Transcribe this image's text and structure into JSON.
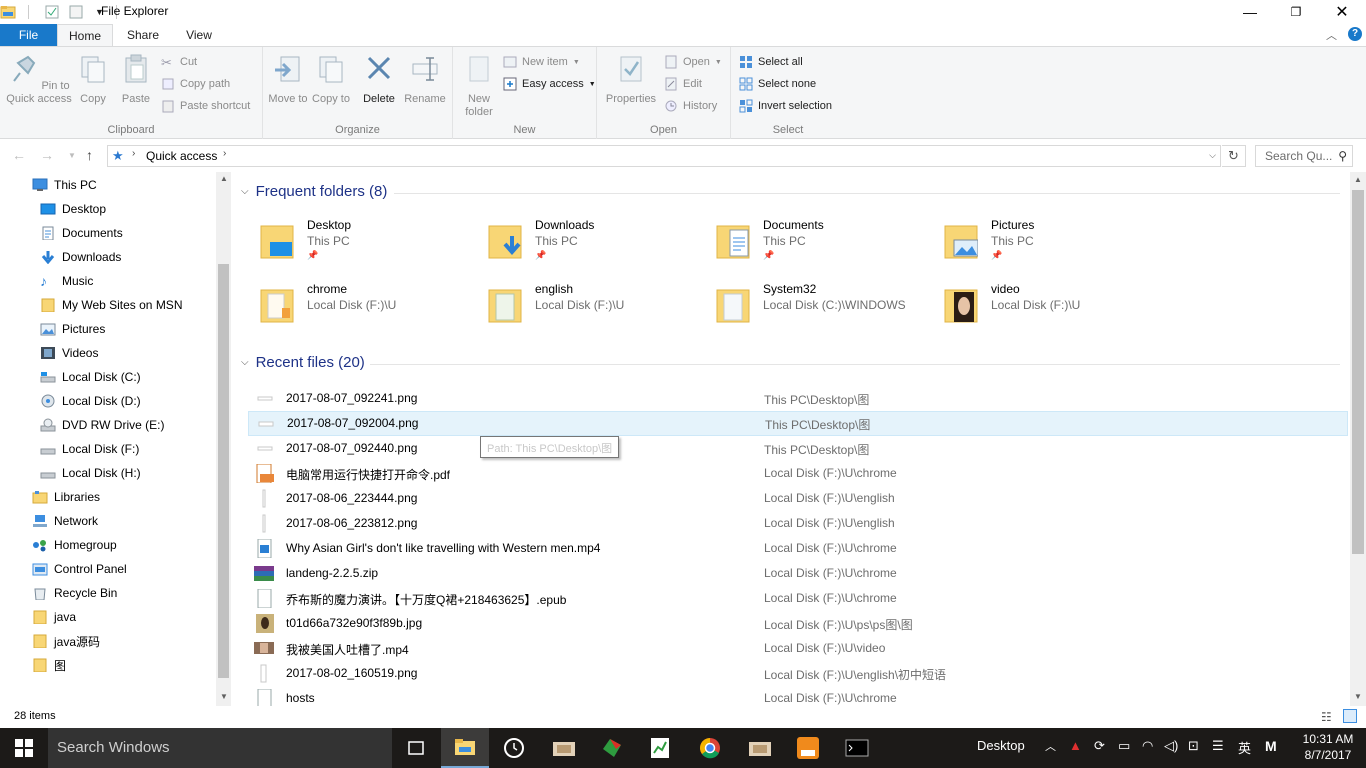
{
  "window": {
    "title": "File Explorer",
    "controls": [
      "minimize",
      "maximize",
      "close"
    ]
  },
  "ribbon_tabs": [
    "File",
    "Home",
    "Share",
    "View"
  ],
  "ribbon": {
    "clipboard": {
      "label": "Clipboard",
      "pin": "Pin to Quick access",
      "copy": "Copy",
      "paste": "Paste",
      "cut": "Cut",
      "copy_path": "Copy path",
      "paste_shortcut": "Paste shortcut"
    },
    "organize": {
      "label": "Organize",
      "move_to": "Move to",
      "copy_to": "Copy to",
      "delete": "Delete",
      "rename": "Rename"
    },
    "new": {
      "label": "New",
      "new_folder": "New folder",
      "new_item": "New item",
      "easy_access": "Easy access"
    },
    "open": {
      "label": "Open",
      "properties": "Properties",
      "open": "Open",
      "edit": "Edit",
      "history": "History"
    },
    "select": {
      "label": "Select",
      "select_all": "Select all",
      "select_none": "Select none",
      "invert": "Invert selection"
    }
  },
  "address": {
    "path": "Quick access",
    "search_placeholder": "Search Qu..."
  },
  "nav_items": [
    {
      "label": "This PC",
      "icon": "computer-icon",
      "level": 0
    },
    {
      "label": "Desktop",
      "icon": "desktop-icon",
      "level": 1
    },
    {
      "label": "Documents",
      "icon": "documents-icon",
      "level": 1
    },
    {
      "label": "Downloads",
      "icon": "downloads-icon",
      "level": 1
    },
    {
      "label": "Music",
      "icon": "music-icon",
      "level": 1
    },
    {
      "label": "My Web Sites on MSN",
      "icon": "folder-icon",
      "level": 1
    },
    {
      "label": "Pictures",
      "icon": "pictures-icon",
      "level": 1
    },
    {
      "label": "Videos",
      "icon": "videos-icon",
      "level": 1
    },
    {
      "label": "Local Disk (C:)",
      "icon": "drive-icon",
      "level": 1
    },
    {
      "label": "Local Disk (D:)",
      "icon": "disc-drive-icon",
      "level": 1
    },
    {
      "label": "DVD RW Drive (E:)",
      "icon": "dvd-drive-icon",
      "level": 1
    },
    {
      "label": "Local Disk (F:)",
      "icon": "drive-icon",
      "level": 1
    },
    {
      "label": "Local Disk (H:)",
      "icon": "drive-icon",
      "level": 1
    },
    {
      "label": "Libraries",
      "icon": "libraries-icon",
      "level": 0
    },
    {
      "label": "Network",
      "icon": "network-icon",
      "level": 0
    },
    {
      "label": "Homegroup",
      "icon": "homegroup-icon",
      "level": 0
    },
    {
      "label": "Control Panel",
      "icon": "control-panel-icon",
      "level": 0
    },
    {
      "label": "Recycle Bin",
      "icon": "recycle-bin-icon",
      "level": 0
    },
    {
      "label": "java",
      "icon": "folder-icon",
      "level": 0
    },
    {
      "label": "java源码",
      "icon": "folder-icon",
      "level": 0
    },
    {
      "label": "图",
      "icon": "folder-icon",
      "level": 0
    }
  ],
  "frequent": {
    "heading": "Frequent folders (8)",
    "folders": [
      {
        "name": "Desktop",
        "sub": "This PC",
        "pinned": true
      },
      {
        "name": "Downloads",
        "sub": "This PC",
        "pinned": true
      },
      {
        "name": "Documents",
        "sub": "This PC",
        "pinned": true
      },
      {
        "name": "Pictures",
        "sub": "This PC",
        "pinned": true
      },
      {
        "name": "chrome",
        "sub": "Local Disk (F:)\\U",
        "pinned": false
      },
      {
        "name": "english",
        "sub": "Local Disk (F:)\\U",
        "pinned": false
      },
      {
        "name": "System32",
        "sub": "Local Disk (C:)\\WINDOWS",
        "pinned": false
      },
      {
        "name": "video",
        "sub": "Local Disk (F:)\\U",
        "pinned": false
      }
    ]
  },
  "recent": {
    "heading": "Recent files (20)",
    "files": [
      {
        "name": "2017-08-07_092241.png",
        "location": "This PC\\Desktop\\图",
        "icon": "image-file-icon"
      },
      {
        "name": "2017-08-07_092004.png",
        "location": "This PC\\Desktop\\图",
        "icon": "image-file-icon"
      },
      {
        "name": "2017-08-07_092440.png",
        "location": "This PC\\Desktop\\图",
        "icon": "image-file-icon"
      },
      {
        "name": "电脑常用运行快捷打开命令.pdf",
        "location": "Local Disk (F:)\\U\\chrome",
        "icon": "pdf-file-icon"
      },
      {
        "name": "2017-08-06_223444.png",
        "location": "Local Disk (F:)\\U\\english",
        "icon": "image-file-icon"
      },
      {
        "name": "2017-08-06_223812.png",
        "location": "Local Disk (F:)\\U\\english",
        "icon": "image-file-icon"
      },
      {
        "name": "Why Asian Girl's don't like travelling with Western men.mp4",
        "location": "Local Disk (F:)\\U\\chrome",
        "icon": "video-file-icon"
      },
      {
        "name": "landeng-2.2.5.zip",
        "location": "Local Disk (F:)\\U\\chrome",
        "icon": "zip-file-icon"
      },
      {
        "name": "乔布斯的魔力演讲。【十万度Q裙+218463625】.epub",
        "location": "Local Disk (F:)\\U\\chrome",
        "icon": "generic-file-icon"
      },
      {
        "name": "t01d66a732e90f3f89b.jpg",
        "location": "Local Disk (F:)\\U\\ps\\ps图\\图",
        "icon": "photo-file-icon"
      },
      {
        "name": "我被美国人吐槽了.mp4",
        "location": "Local Disk (F:)\\U\\video",
        "icon": "video-thumb-icon"
      },
      {
        "name": "2017-08-02_160519.png",
        "location": "Local Disk (F:)\\U\\english\\初中短语",
        "icon": "image-file-icon"
      },
      {
        "name": "hosts",
        "location": "Local Disk (F:)\\U\\chrome",
        "icon": "generic-file-icon"
      }
    ]
  },
  "tooltip": "Path: This PC\\Desktop\\图",
  "status": {
    "items": "28 items"
  },
  "taskbar": {
    "search_placeholder": "Search Windows",
    "desktop_label": "Desktop",
    "ime": "英",
    "clock_time": "10:31 AM",
    "clock_date": "8/7/2017"
  },
  "colors": {
    "accent": "#1979ca",
    "heading": "#1e3287",
    "selection": "#e5f3fb",
    "folder": "#f8d675"
  }
}
